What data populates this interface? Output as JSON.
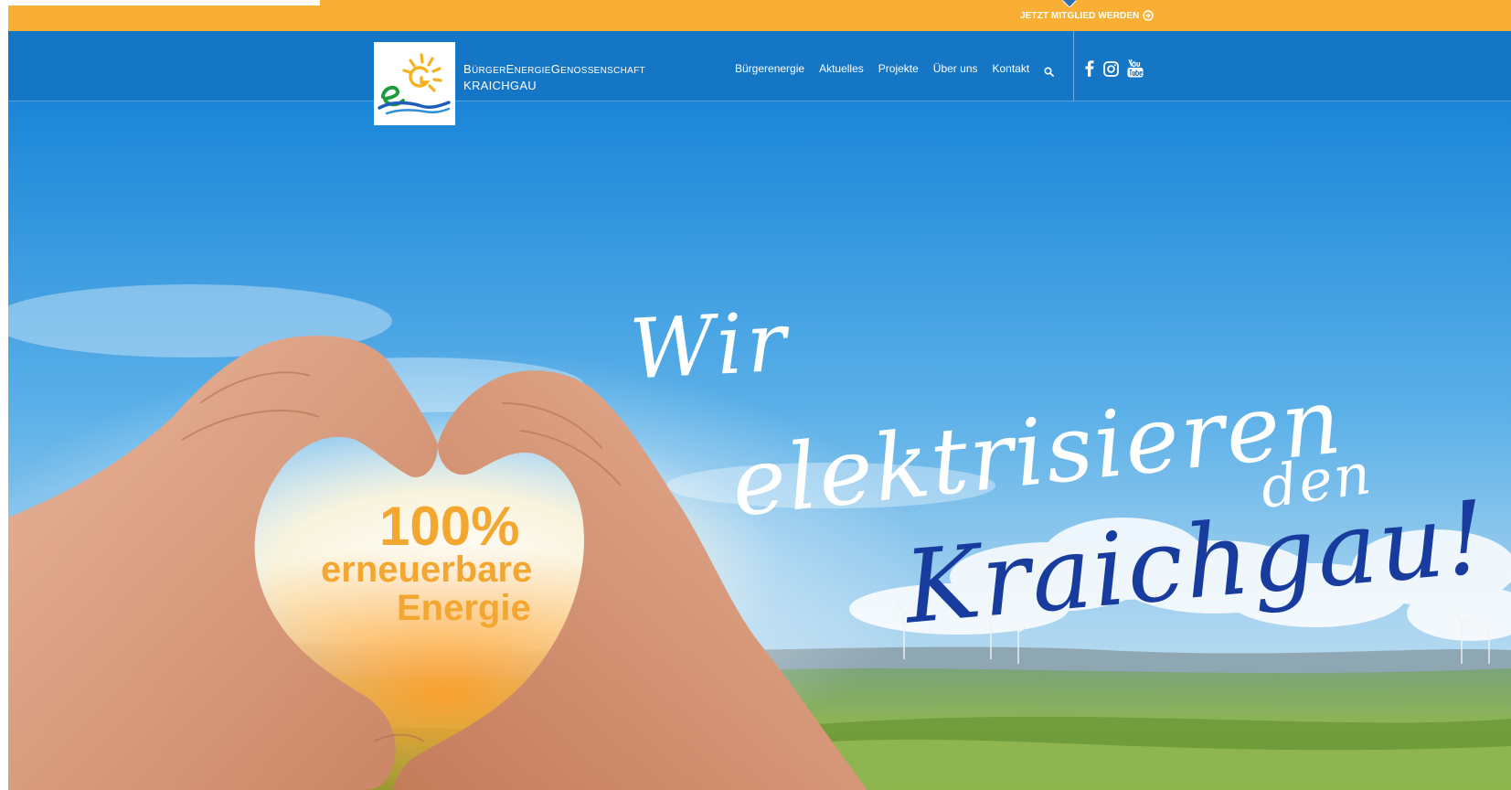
{
  "topbar": {
    "member_link": "JETZT MITGLIED WERDEN",
    "color": "#f8af33"
  },
  "header": {
    "background": "#1676c6",
    "brand_line1_parts": [
      "B",
      "ÜRGER",
      "E",
      "NERGIE",
      "G",
      "ENOSSENSCHAFT"
    ],
    "brand_line2": "KRAICHGAU",
    "nav": [
      {
        "label": "Bürgerenergie"
      },
      {
        "label": "Aktuelles"
      },
      {
        "label": "Projekte"
      },
      {
        "label": "Über uns"
      },
      {
        "label": "Kontakt"
      }
    ],
    "search_icon": "search-icon",
    "social": [
      "facebook-icon",
      "instagram-icon",
      "youtube-icon"
    ]
  },
  "hero": {
    "script_line1": "Wir",
    "script_line2": "elektrisieren",
    "script_line3": "den",
    "script_line4": "Kraichgau!",
    "badge_percent": "100%",
    "badge_line2": "erneuerbare",
    "badge_line3": "Energie",
    "accent_orange": "#f4a730",
    "accent_blue": "#183c9e"
  }
}
